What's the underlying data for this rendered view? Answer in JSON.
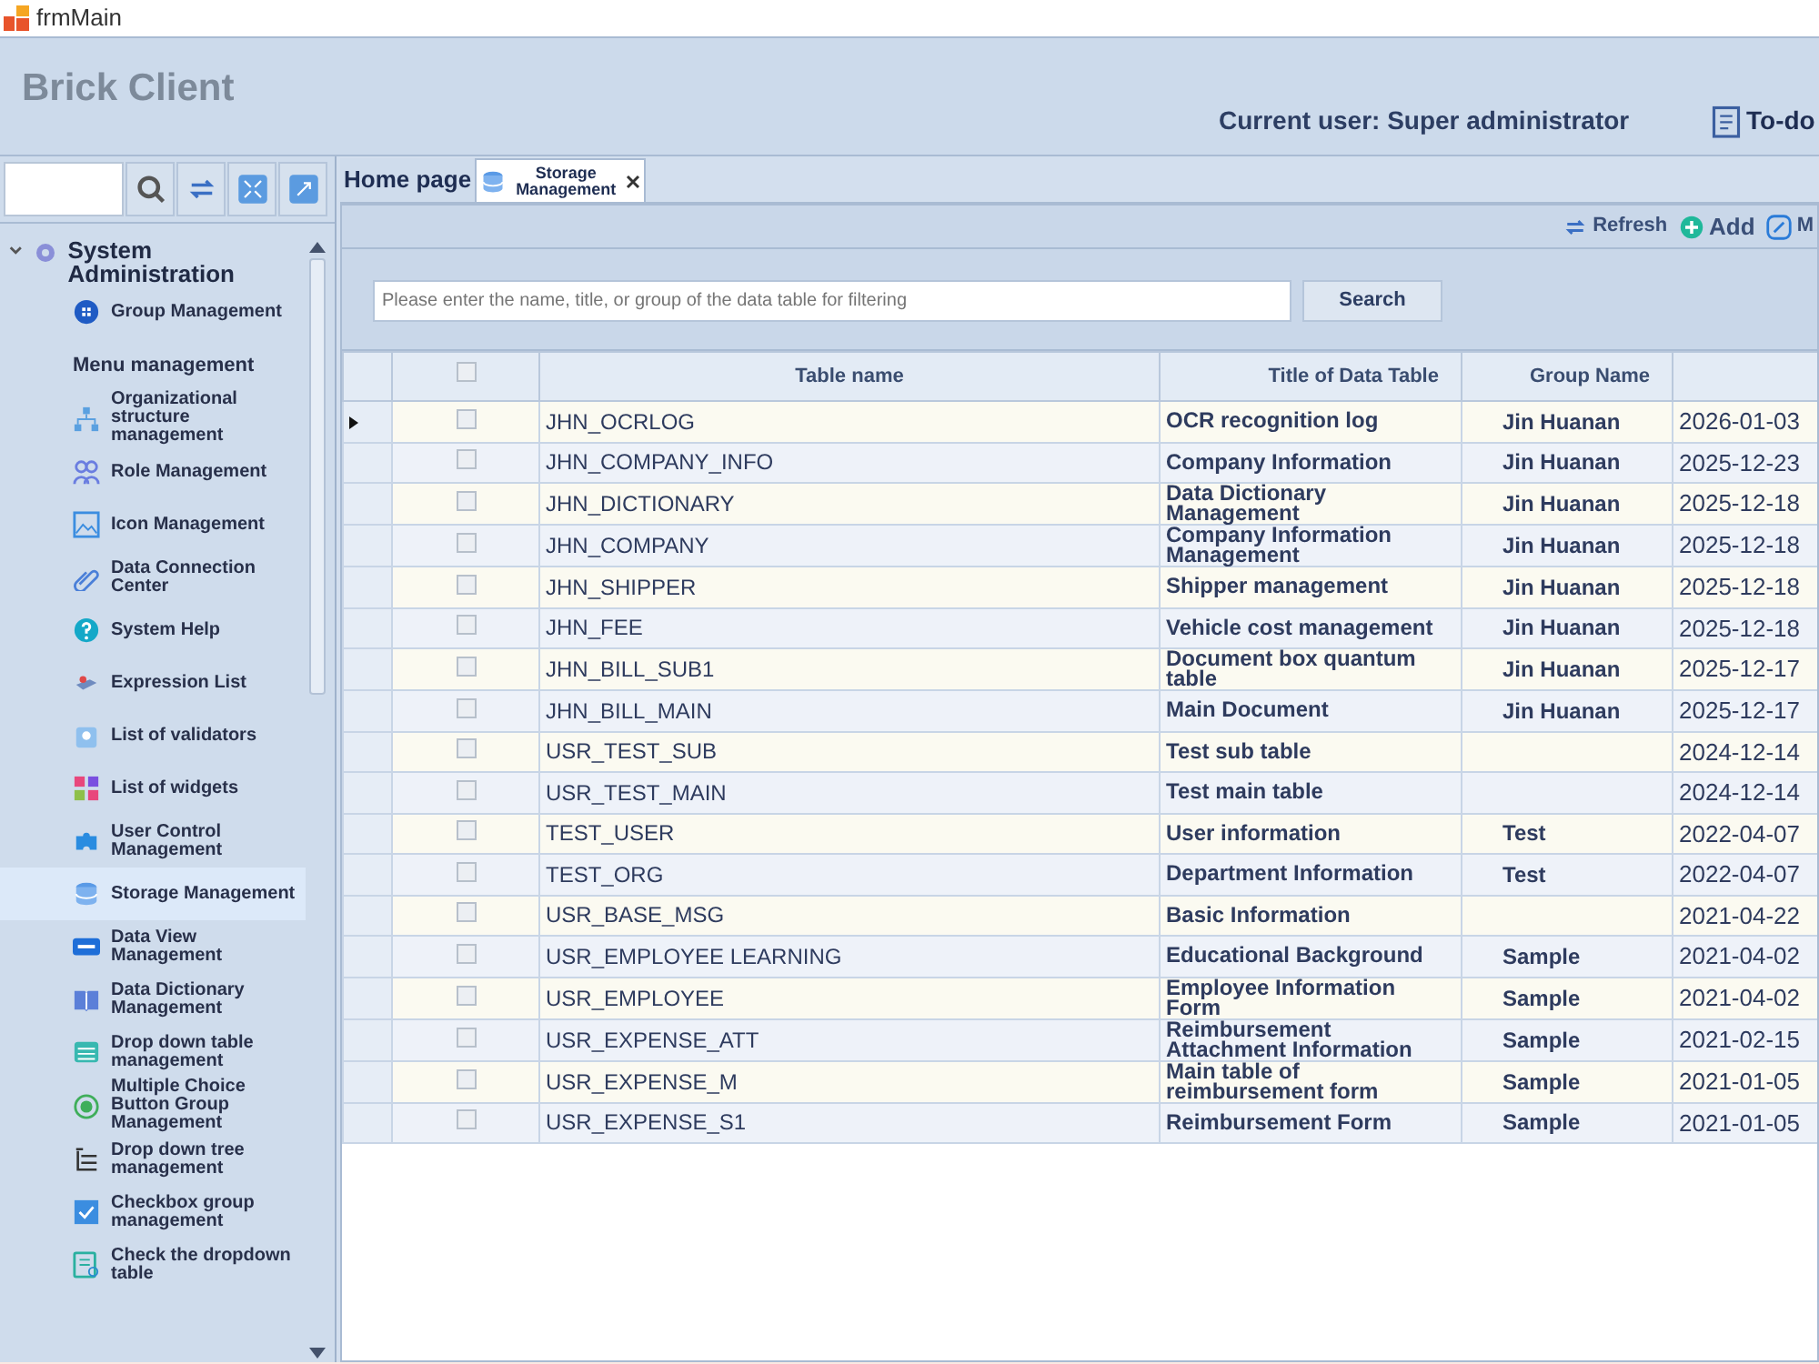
{
  "window": {
    "title": "frmMain"
  },
  "header": {
    "app_name": "Brick Client",
    "current_user": "Current user: Super administrator",
    "todo": "To-do"
  },
  "sidebar": {
    "items": [
      {
        "label": "System Administration",
        "kind": "gear",
        "expanded": true,
        "selected": false,
        "children": [
          {
            "label": "Group Management",
            "kind": "group",
            "selected": false
          },
          {
            "label": "Menu management",
            "kind": "none",
            "selected": false
          },
          {
            "label": "Organizational structure management",
            "kind": "org",
            "selected": false
          },
          {
            "label": "Role Management",
            "kind": "role",
            "selected": false
          },
          {
            "label": "Icon Management",
            "kind": "image",
            "selected": false
          },
          {
            "label": "Data Connection Center",
            "kind": "link",
            "selected": false
          },
          {
            "label": "System Help",
            "kind": "help",
            "selected": false
          },
          {
            "label": "Expression List",
            "kind": "expression",
            "selected": false
          },
          {
            "label": "List of validators",
            "kind": "validator",
            "selected": false
          },
          {
            "label": "List of widgets",
            "kind": "widgets",
            "selected": false
          },
          {
            "label": "User Control Management",
            "kind": "puzzle",
            "selected": false
          },
          {
            "label": "Storage Management",
            "kind": "database",
            "selected": true
          },
          {
            "label": "Data View Management",
            "kind": "sql",
            "selected": false
          },
          {
            "label": "Data Dictionary Management",
            "kind": "book",
            "selected": false
          },
          {
            "label": "Drop down table management",
            "kind": "table",
            "selected": false
          },
          {
            "label": "Multiple Choice Button Group Management",
            "kind": "radio",
            "selected": false
          },
          {
            "label": "Drop down tree management",
            "kind": "tree",
            "selected": false
          },
          {
            "label": "Checkbox group management",
            "kind": "checkbox",
            "selected": false
          },
          {
            "label": "Check the dropdown table",
            "kind": "dropdown",
            "selected": false
          }
        ]
      }
    ]
  },
  "tabs": [
    {
      "label": "Home page",
      "selected": false,
      "closable": false
    },
    {
      "label": "Storage Management",
      "selected": true,
      "closable": true
    }
  ],
  "toolbar": [
    {
      "label": "Refresh",
      "kind": "refresh"
    },
    {
      "label": "Add",
      "kind": "add"
    },
    {
      "label": "M",
      "kind": "edit"
    }
  ],
  "filter": {
    "placeholder": "Please enter the name, title, or group of the data table for filtering",
    "button": "Search"
  },
  "table": {
    "columns": [
      "Table name",
      "Title of Data Table",
      "Group Name"
    ],
    "all_checked": false,
    "rows": [
      {
        "name": "JHN_OCRLOG",
        "title": "OCR recognition log",
        "group": "Jin Huanan",
        "date": "2026-01-03",
        "current": true,
        "checked": false
      },
      {
        "name": "JHN_COMPANY_INFO",
        "title": "Company Information",
        "group": "Jin Huanan",
        "date": "2025-12-23",
        "current": false,
        "checked": false
      },
      {
        "name": "JHN_DICTIONARY",
        "title": "Data Dictionary Management",
        "group": "Jin Huanan",
        "date": "2025-12-18",
        "current": false,
        "checked": false
      },
      {
        "name": "JHN_COMPANY",
        "title": "Company Information Management",
        "group": "Jin Huanan",
        "date": "2025-12-18",
        "current": false,
        "checked": false
      },
      {
        "name": "JHN_SHIPPER",
        "title": "Shipper management",
        "group": "Jin Huanan",
        "date": "2025-12-18",
        "current": false,
        "checked": false
      },
      {
        "name": "JHN_FEE",
        "title": "Vehicle cost management",
        "group": "Jin Huanan",
        "date": "2025-12-18",
        "current": false,
        "checked": false
      },
      {
        "name": "JHN_BILL_SUB1",
        "title": "Document box quantum table",
        "group": "Jin Huanan",
        "date": "2025-12-17",
        "current": false,
        "checked": false
      },
      {
        "name": "JHN_BILL_MAIN",
        "title": "Main Document",
        "group": "Jin Huanan",
        "date": "2025-12-17",
        "current": false,
        "checked": false
      },
      {
        "name": "USR_TEST_SUB",
        "title": "Test sub table",
        "group": "",
        "date": "2024-12-14",
        "current": false,
        "checked": false
      },
      {
        "name": "USR_TEST_MAIN",
        "title": "Test main table",
        "group": "",
        "date": "2024-12-14",
        "current": false,
        "checked": false
      },
      {
        "name": "TEST_USER",
        "title": "User information",
        "group": "Test",
        "date": "2022-04-07",
        "current": false,
        "checked": false
      },
      {
        "name": "TEST_ORG",
        "title": "Department Information",
        "group": "Test",
        "date": "2022-04-07",
        "current": false,
        "checked": false
      },
      {
        "name": "USR_BASE_MSG",
        "title": "Basic Information",
        "group": "",
        "date": "2021-04-22",
        "current": false,
        "checked": false
      },
      {
        "name": "USR_EMPLOYEE LEARNING",
        "title": "Educational Background",
        "group": "Sample",
        "date": "2021-04-02",
        "current": false,
        "checked": false
      },
      {
        "name": "USR_EMPLOYEE",
        "title": "Employee Information Form",
        "group": "Sample",
        "date": "2021-04-02",
        "current": false,
        "checked": false
      },
      {
        "name": "USR_EXPENSE_ATT",
        "title": "Reimbursement Attachment Information",
        "group": "Sample",
        "date": "2021-02-15",
        "current": false,
        "checked": false
      },
      {
        "name": "USR_EXPENSE_M",
        "title": "Main table of reimbursement form",
        "group": "Sample",
        "date": "2021-01-05",
        "current": false,
        "checked": false
      },
      {
        "name": "USR_EXPENSE_S1",
        "title": "Reimbursement Form",
        "group": "Sample",
        "date": "2021-01-05",
        "current": false,
        "checked": false
      }
    ]
  }
}
